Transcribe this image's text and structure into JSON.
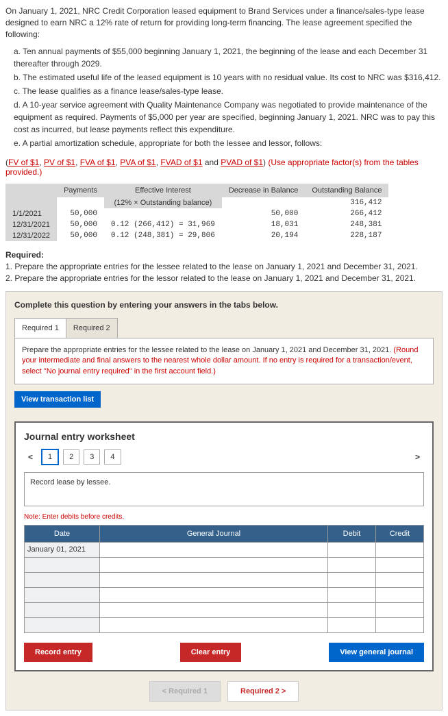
{
  "intro": "On January 1, 2021, NRC Credit Corporation leased equipment to Brand Services under a finance/sales-type lease designed to earn NRC a 12% rate of return for providing long-term financing. The lease agreement specified the following:",
  "list": {
    "a": "a. Ten annual payments of $55,000 beginning January 1, 2021, the beginning of the lease and each December 31 thereafter through 2029.",
    "b": "b. The estimated useful life of the leased equipment is 10 years with no residual value. Its cost to NRC was $316,412.",
    "c": "c. The lease qualifies as a finance lease/sales-type lease.",
    "d": "d. A 10-year service agreement with Quality Maintenance Company was negotiated to provide maintenance of the equipment as required. Payments of $5,000 per year are specified, beginning January 1, 2021. NRC was to pay this cost as incurred, but lease payments reflect this expenditure.",
    "e": "e. A partial amortization schedule, appropriate for both the lessee and lessor, follows:"
  },
  "links": {
    "prefix": "(",
    "l1": "FV of $1",
    "l2": "PV of $1",
    "l3": "FVA of $1",
    "l4": "PVA of $1",
    "l5": "FVAD of $1",
    "and": " and ",
    "l6": "PVAD of $1",
    "suffix": ") ",
    "note": "(Use appropriate factor(s) from the tables provided.)"
  },
  "amort": {
    "h_payments": "Payments",
    "h_effective": "Effective Interest",
    "h_sub": "(12% × Outstanding balance)",
    "h_decrease": "Decrease in Balance",
    "h_outstanding": "Outstanding Balance",
    "r0_out": "316,412",
    "r1_date": "1/1/2021",
    "r1_pay": "50,000",
    "r1_dec": "50,000",
    "r1_out": "266,412",
    "r2_date": "12/31/2021",
    "r2_pay": "50,000",
    "r2_eff": "0.12 (266,412) = 31,969",
    "r2_dec": "18,031",
    "r2_out": "248,381",
    "r3_date": "12/31/2022",
    "r3_pay": "50,000",
    "r3_eff": "0.12 (248,381) = 29,806",
    "r3_dec": "20,194",
    "r3_out": "228,187"
  },
  "required": {
    "title": "Required:",
    "r1": "1. Prepare the appropriate entries for the lessee related to the lease on January 1, 2021 and December 31, 2021.",
    "r2": "2. Prepare the appropriate entries for the lessor related to the lease on January 1, 2021 and December 31, 2021."
  },
  "qbox": {
    "intro": "Complete this question by entering your answers in the tabs below.",
    "tab1": "Required 1",
    "tab2": "Required 2",
    "instr_black": "Prepare the appropriate entries for the lessee related to the lease on January 1, 2021 and December 31, 2021. ",
    "instr_red": "(Round your intermediate and final answers to the nearest whole dollar amount. If no entry is required for a transaction/event, select \"No journal entry required\" in the first account field.)"
  },
  "view_btn": "View transaction list",
  "worksheet": {
    "title": "Journal entry worksheet",
    "nav": [
      "1",
      "2",
      "3",
      "4"
    ],
    "arrow_left": "<",
    "arrow_right": ">",
    "record": "Record lease by lessee.",
    "note": "Note: Enter debits before credits.",
    "cols": {
      "date": "Date",
      "gj": "General Journal",
      "debit": "Debit",
      "credit": "Credit"
    },
    "date_val": "January 01, 2021",
    "record_btn": "Record entry",
    "clear_btn": "Clear entry",
    "view_gj_btn": "View general journal"
  },
  "bottom": {
    "prev": "< Required 1",
    "next": "Required 2 >"
  }
}
